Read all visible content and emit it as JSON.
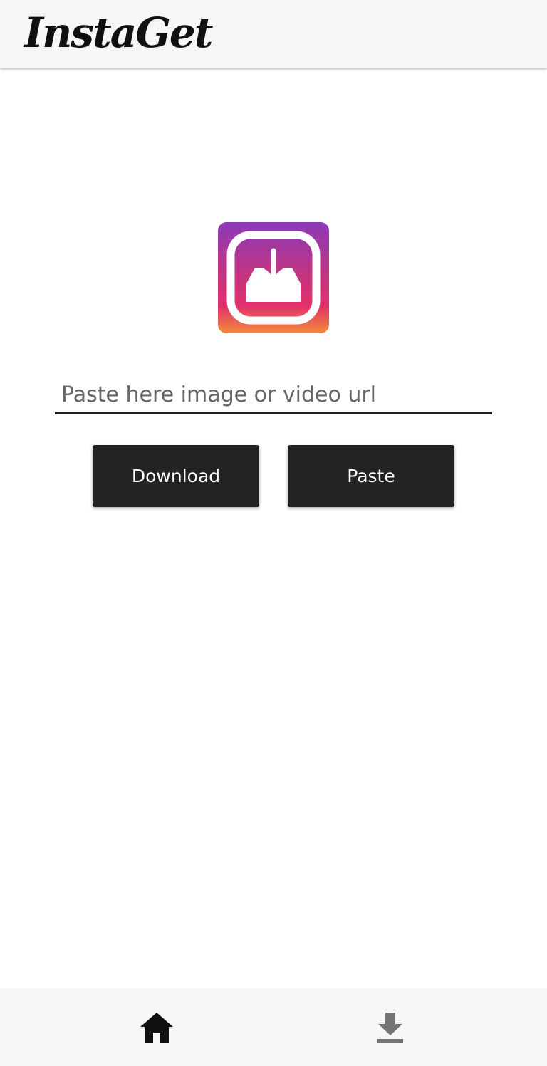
{
  "app_bar": {
    "title": "InstaGet"
  },
  "logo": {
    "icon": "download-inbox-icon",
    "gradient_colors": [
      "#8a3ab9",
      "#c13584",
      "#e1306c",
      "#f77737"
    ]
  },
  "url_input": {
    "placeholder": "Paste here image or video url",
    "value": ""
  },
  "buttons": {
    "download_label": "Download",
    "paste_label": "Paste"
  },
  "bottom_nav": {
    "items": [
      {
        "icon": "home-icon",
        "active": true
      },
      {
        "icon": "download-icon",
        "active": false
      }
    ]
  },
  "colors": {
    "button_background": "#232323",
    "active_nav_icon": "#111111",
    "inactive_nav_icon": "#757575"
  }
}
